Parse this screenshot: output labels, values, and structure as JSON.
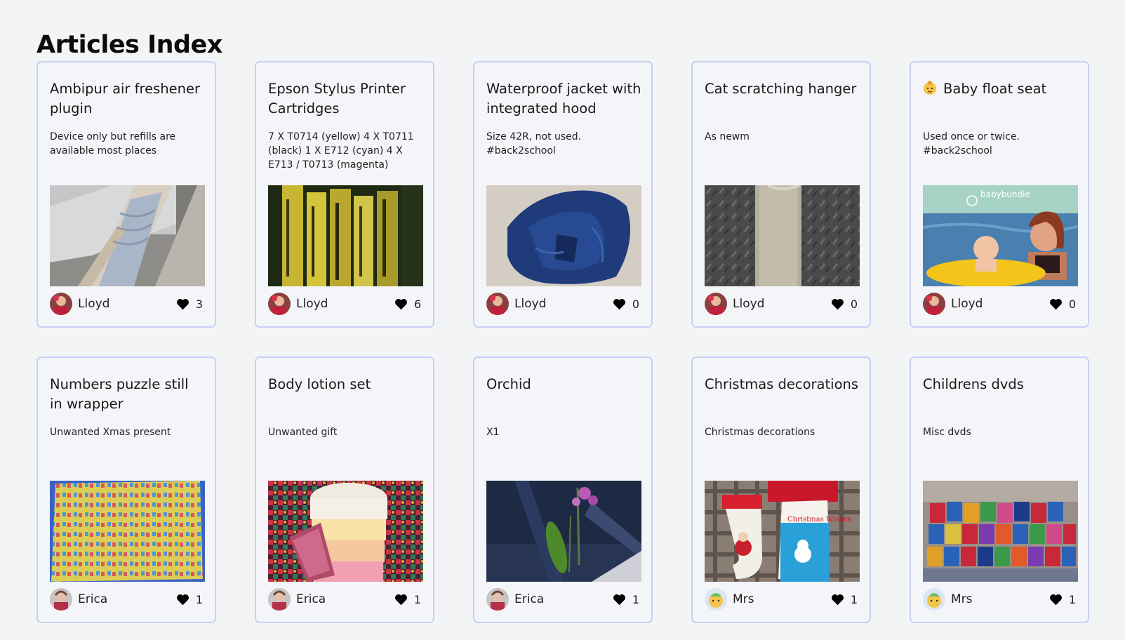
{
  "page": {
    "title": "Articles Index"
  },
  "articles": [
    {
      "title": "Ambipur air freshener plugin",
      "description": "Device only but refills are available most places",
      "image": "air-freshener-photo",
      "author": "Lloyd",
      "avatar": "lloyd-avatar",
      "likes": "3"
    },
    {
      "title": "Epson Stylus Printer Cartridges",
      "description": "7 X T0714 (yellow) 4 X T0711 (black) 1 X E712 (cyan) 4 X E713 / T0713 (magenta)",
      "image": "printer-cartridges-photo",
      "author": "Lloyd",
      "avatar": "lloyd-avatar",
      "likes": "6"
    },
    {
      "title": "Waterproof jacket with integrated hood",
      "description": "Size 42R, not used.\n#back2school",
      "image": "blue-jacket-photo",
      "author": "Lloyd",
      "avatar": "lloyd-avatar",
      "likes": "0"
    },
    {
      "title": "Cat scratching hanger",
      "description": "As newm",
      "image": "cat-scratcher-photo",
      "author": "Lloyd",
      "avatar": "lloyd-avatar",
      "likes": "0"
    },
    {
      "title": "Baby float seat",
      "title_icon": "baby-emoji-icon",
      "description": "Used once or twice.\n#back2school",
      "image": "baby-float-photo",
      "image_text": "babybundle",
      "author": "Lloyd",
      "avatar": "lloyd-avatar",
      "likes": "0"
    },
    {
      "title": "Numbers puzzle still in wrapper",
      "description": "Unwanted Xmas present",
      "image": "numbers-puzzle-photo",
      "author": "Erica",
      "avatar": "erica-avatar",
      "likes": "1"
    },
    {
      "title": "Body lotion set",
      "description": "Unwanted gift",
      "image": "body-lotion-photo",
      "author": "Erica",
      "avatar": "erica-avatar",
      "likes": "1"
    },
    {
      "title": "Orchid",
      "description": "X1",
      "image": "orchid-photo",
      "author": "Erica",
      "avatar": "erica-avatar",
      "likes": "1"
    },
    {
      "title": "Christmas decorations",
      "description": "Christmas decorations",
      "image": "christmas-stockings-photo",
      "image_text": "Christmas Wishes",
      "author": "Mrs",
      "avatar": "mrs-avatar",
      "likes": "1"
    },
    {
      "title": "Childrens dvds",
      "description": "Misc dvds",
      "image": "dvds-photo",
      "author": "Mrs",
      "avatar": "mrs-avatar",
      "likes": "1"
    }
  ],
  "colors": {
    "background": "#f3f4f6",
    "card_border": "#c9d0f4",
    "heart": "#000000"
  }
}
